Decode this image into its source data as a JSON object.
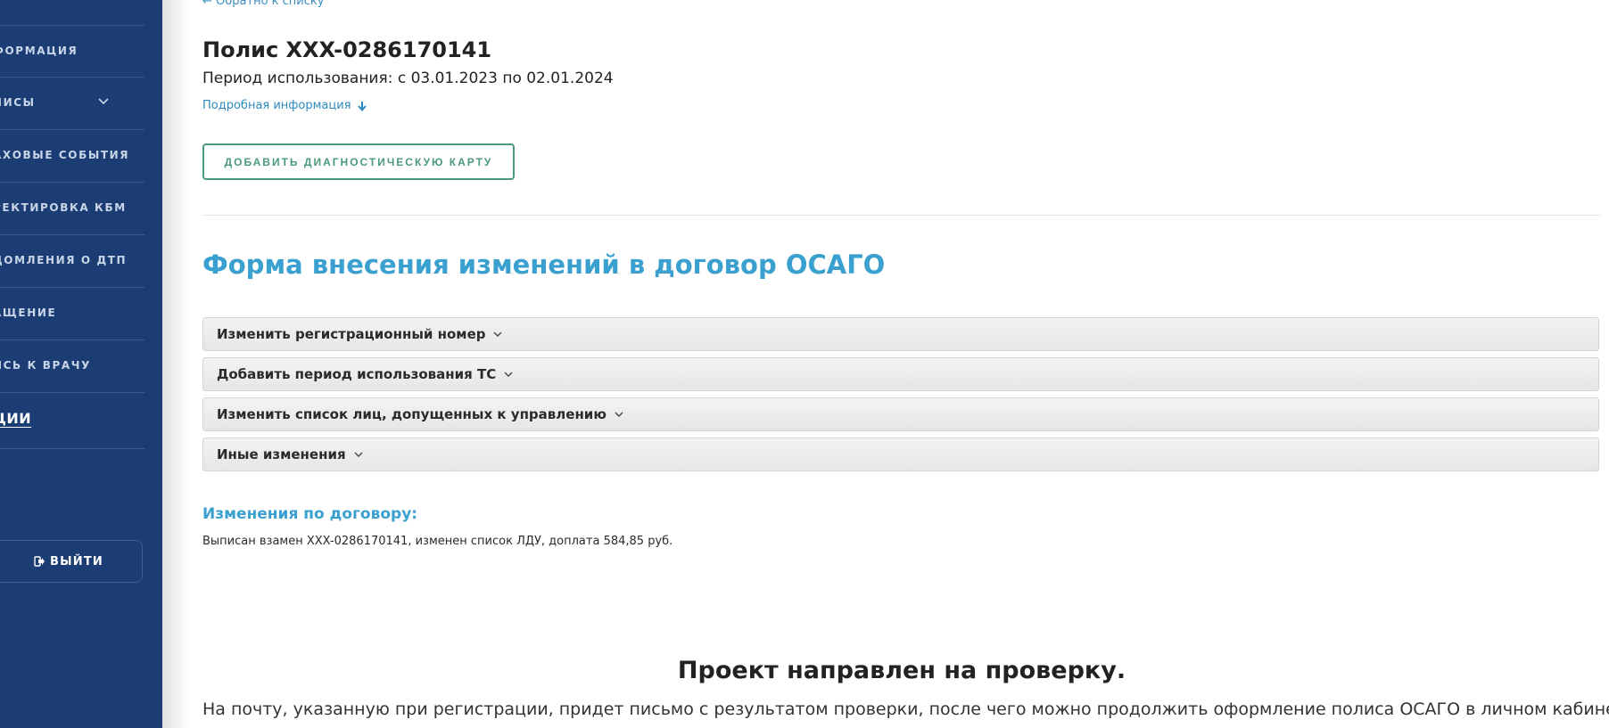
{
  "sidebar": {
    "items": [
      {
        "label": "ФОРМАЦИЯ"
      },
      {
        "label": "ЛИСЫ"
      },
      {
        "label": "АХОВЫЕ СОБЫТИЯ"
      },
      {
        "label": "РЕКТИРОВКА КБМ"
      },
      {
        "label": "ДОМЛЕНИЯ О ДТП"
      },
      {
        "label": "АЩЕНИЕ"
      },
      {
        "label": "ИСЬ К ВРАЧУ"
      },
      {
        "label": "ЦИИ"
      }
    ],
    "logout_label": "ВЫЙТИ"
  },
  "main": {
    "back_link": "← Обратно к списку",
    "policy_title": "Полис XXX-0286170141",
    "period": "Период использования: с 03.01.2023 по 02.01.2024",
    "details_link": "Подробная информация",
    "diag_button": "ДОБАВИТЬ ДИАГНОСТИЧЕСКУЮ КАРТУ",
    "form_title": "Форма внесения изменений в договор ОСАГО",
    "accordions": [
      {
        "label": "Изменить регистрационный номер"
      },
      {
        "label": "Добавить период использования ТС"
      },
      {
        "label": "Изменить список лиц, допущенных к управлению"
      },
      {
        "label": "Иные изменения"
      }
    ],
    "changes_title": "Изменения по договору:",
    "changes_text": "Выписан взамен XXX-0286170141, изменен список ЛДУ, доплата 584,85 руб.",
    "project_title": "Проект направлен на проверку.",
    "project_text": "На почту, указанную при регистрации, придет письмо с результатом проверки, после чего можно продолжить оформление полиса ОСАГО в личном кабинете"
  },
  "colors": {
    "sidebar_bg": "#1c3d73",
    "accent_blue": "#3aa0cf",
    "button_green": "#4a9a7a"
  }
}
